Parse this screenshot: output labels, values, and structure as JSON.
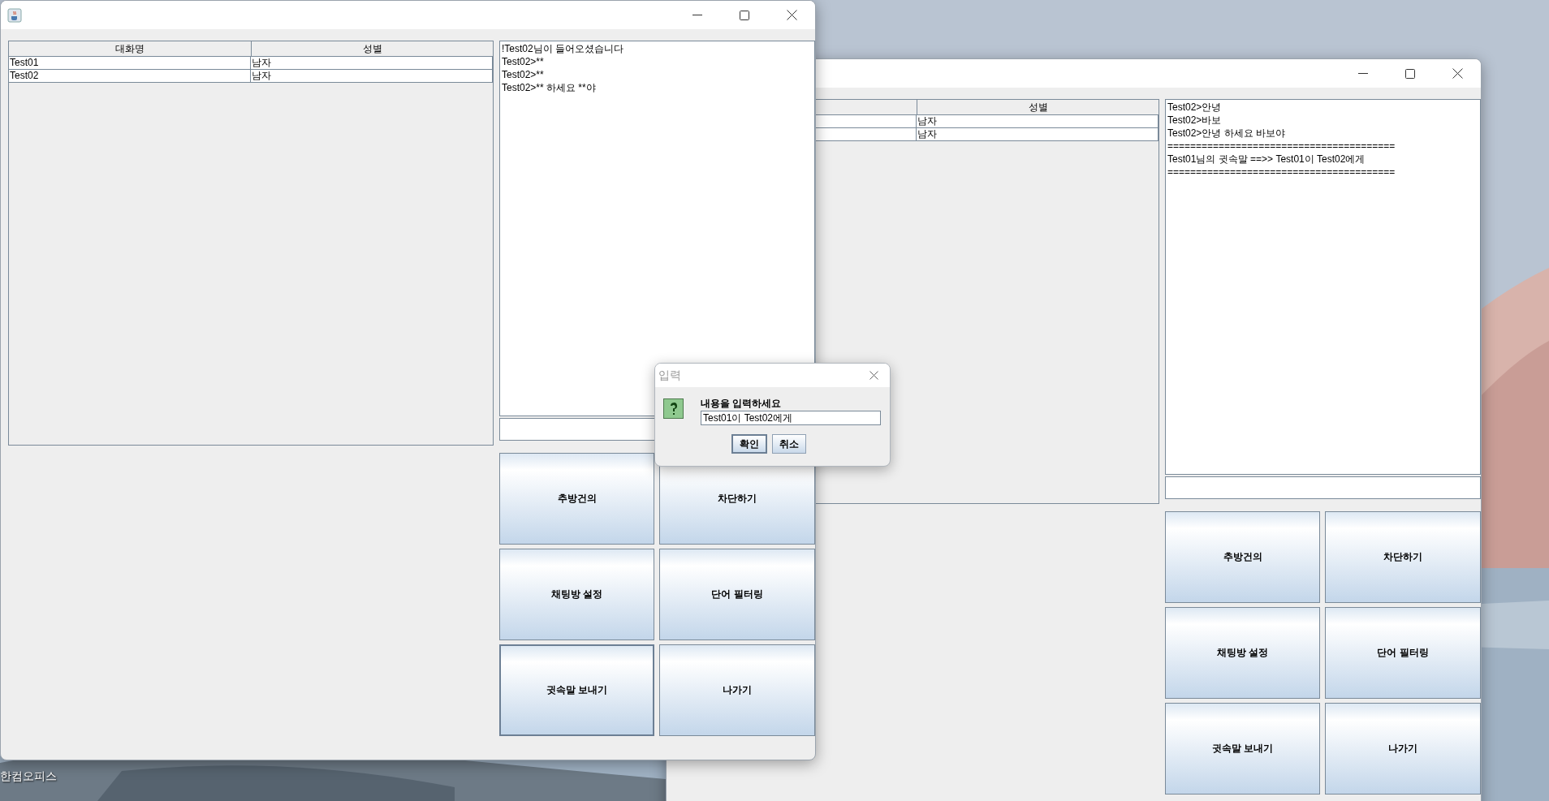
{
  "desktop": {
    "shortcut_label": "한컴오피스"
  },
  "windows": [
    {
      "app_icon": true,
      "table": {
        "columns": [
          {
            "label": "대화명"
          },
          {
            "label": "성별"
          }
        ],
        "rows": [
          [
            "Test01",
            "남자"
          ],
          [
            "Test02",
            "남자"
          ]
        ]
      },
      "chat_lines": [
        "!Test02님이 들어오셨습니다",
        "Test02>**",
        "Test02>**",
        "Test02>** 하세요 **야"
      ],
      "buttons": [
        {
          "label": "추방건의",
          "focused": false
        },
        {
          "label": "차단하기",
          "focused": false
        },
        {
          "label": "채팅방 설정",
          "focused": false
        },
        {
          "label": "단어 필터링",
          "focused": false
        },
        {
          "label": "귓속말 보내기",
          "focused": true
        },
        {
          "label": "나가기",
          "focused": false
        }
      ]
    },
    {
      "table": {
        "columns": [
          {},
          {
            "label": "성별"
          }
        ],
        "rows": [
          [
            null,
            "남자"
          ],
          [
            null,
            "남자"
          ]
        ]
      },
      "chat_lines": [
        "Test02>안녕",
        "Test02>바보",
        "Test02>안녕 하세요 바보야",
        "========================================",
        "Test01님의 귓속말 ==>> Test01이 Test02에게",
        "========================================"
      ],
      "buttons": [
        {
          "label": "추방건의",
          "focused": false
        },
        {
          "label": "차단하기",
          "focused": false
        },
        {
          "label": "채팅방 설정",
          "focused": false
        },
        {
          "label": "단어 필터링",
          "focused": false
        },
        {
          "label": "귓속말 보내기",
          "focused": false
        },
        {
          "label": "나가기",
          "focused": false
        }
      ]
    }
  ],
  "dialog": {
    "title": "입력",
    "message": "내용을 입력하세요",
    "value": "Test01이 Test02에게",
    "buttons": [
      {
        "label": "확인",
        "default": true
      },
      {
        "label": "취소",
        "default": false
      }
    ]
  }
}
